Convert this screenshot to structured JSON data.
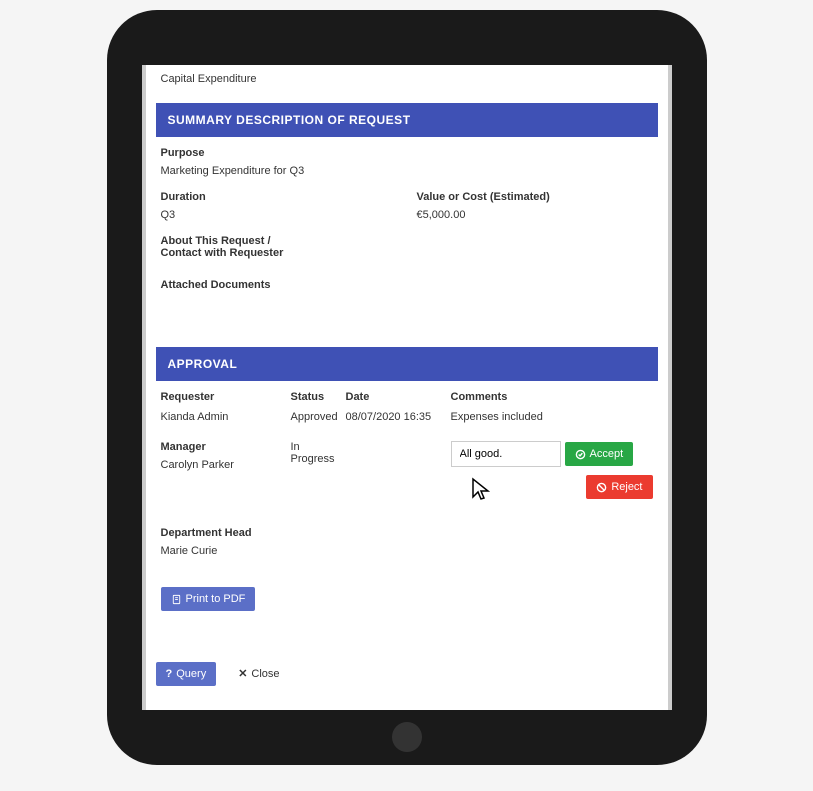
{
  "top": {
    "line": "Capital Expenditure"
  },
  "summary": {
    "header": "SUMMARY DESCRIPTION OF REQUEST",
    "purpose_label": "Purpose",
    "purpose_value": "Marketing Expenditure for Q3",
    "duration_label": "Duration",
    "duration_value": "Q3",
    "value_label": "Value or Cost (Estimated)",
    "value_value": "€5,000.00",
    "about_label": "About This Request / Contact with Requester",
    "attached_label": "Attached Documents"
  },
  "approval": {
    "header": "APPROVAL",
    "col_requester": "Requester",
    "col_status": "Status",
    "col_date": "Date",
    "col_comments": "Comments",
    "requester_name": "Kianda Admin",
    "requester_status": "Approved",
    "requester_date": "08/07/2020 16:35",
    "requester_comments": "Expenses included",
    "manager_label": "Manager",
    "manager_name": "Carolyn Parker",
    "manager_status": "In Progress",
    "comment_input": "All good.",
    "accept_label": "Accept",
    "reject_label": "Reject",
    "dept_label": "Department Head",
    "dept_name": "Marie Curie",
    "print_label": "Print to PDF"
  },
  "bottom": {
    "query_label": "Query",
    "close_label": "Close"
  }
}
